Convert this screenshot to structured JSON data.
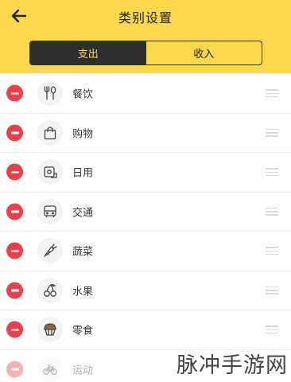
{
  "header": {
    "title": "类别设置",
    "back_icon": "arrow-left-icon",
    "accent_color": "#FBD84C"
  },
  "tabs": [
    {
      "label": "支出",
      "active": true
    },
    {
      "label": "收入",
      "active": false
    }
  ],
  "categories": [
    {
      "label": "餐饮",
      "icon": "fork-spoon-icon"
    },
    {
      "label": "购物",
      "icon": "shopping-bag-icon"
    },
    {
      "label": "日用",
      "icon": "tissue-roll-icon"
    },
    {
      "label": "交通",
      "icon": "bus-icon"
    },
    {
      "label": "蔬菜",
      "icon": "carrot-icon"
    },
    {
      "label": "水果",
      "icon": "cherry-icon"
    },
    {
      "label": "零食",
      "icon": "cupcake-icon"
    },
    {
      "label": "运动",
      "icon": "bicycle-icon"
    }
  ],
  "watermark": "脉冲手游网",
  "colors": {
    "remove": "#E8414B",
    "dark": "#2d2d2d"
  }
}
